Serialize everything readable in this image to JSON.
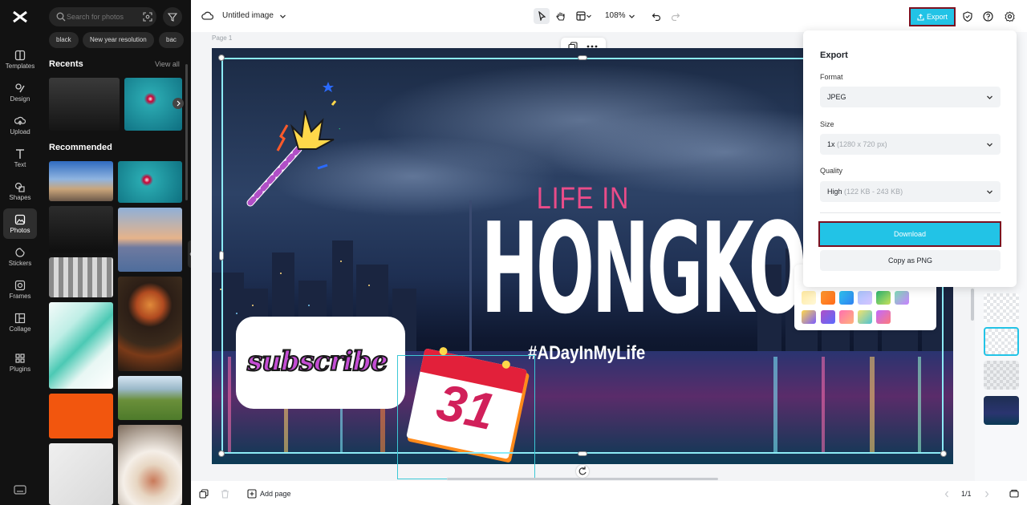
{
  "sidebar": {
    "items": [
      {
        "label": "Templates",
        "icon": "templates-icon"
      },
      {
        "label": "Design",
        "icon": "design-icon"
      },
      {
        "label": "Upload",
        "icon": "upload-icon"
      },
      {
        "label": "Text",
        "icon": "text-icon"
      },
      {
        "label": "Shapes",
        "icon": "shapes-icon"
      },
      {
        "label": "Photos",
        "icon": "photos-icon",
        "active": true
      },
      {
        "label": "Stickers",
        "icon": "stickers-icon"
      },
      {
        "label": "Frames",
        "icon": "frames-icon"
      },
      {
        "label": "Collage",
        "icon": "collage-icon"
      },
      {
        "label": "Plugins",
        "icon": "plugins-icon"
      }
    ]
  },
  "photos_panel": {
    "search_placeholder": "Search for photos",
    "tags": [
      "black",
      "New year resolution",
      "bac"
    ],
    "recents_title": "Recents",
    "view_all": "View all",
    "recommended_title": "Recommended"
  },
  "topbar": {
    "doc_title": "Untitled image",
    "zoom": "108%",
    "export_label": "Export"
  },
  "canvas": {
    "page_label": "Page 1",
    "headline_small": "LIFE IN",
    "headline_big": "HONGKONG",
    "hashtag": "#ADayInMyLife",
    "subscribe": "subscribe",
    "calendar_day": "31"
  },
  "export_panel": {
    "title": "Export",
    "format_label": "Format",
    "format_value": "JPEG",
    "size_label": "Size",
    "size_value": "1x",
    "size_detail": "(1280 x 720 px)",
    "quality_label": "Quality",
    "quality_value": "High",
    "quality_detail": "(122 KB - 243 KB)",
    "download_label": "Download",
    "copy_label": "Copy as PNG"
  },
  "bottombar": {
    "add_page": "Add page",
    "page_counter": "1/1"
  },
  "colors": {
    "accent": "#22c3e6",
    "highlight_border": "#7b1020",
    "pink": "#ea4c89",
    "rail_bg": "#121212"
  }
}
